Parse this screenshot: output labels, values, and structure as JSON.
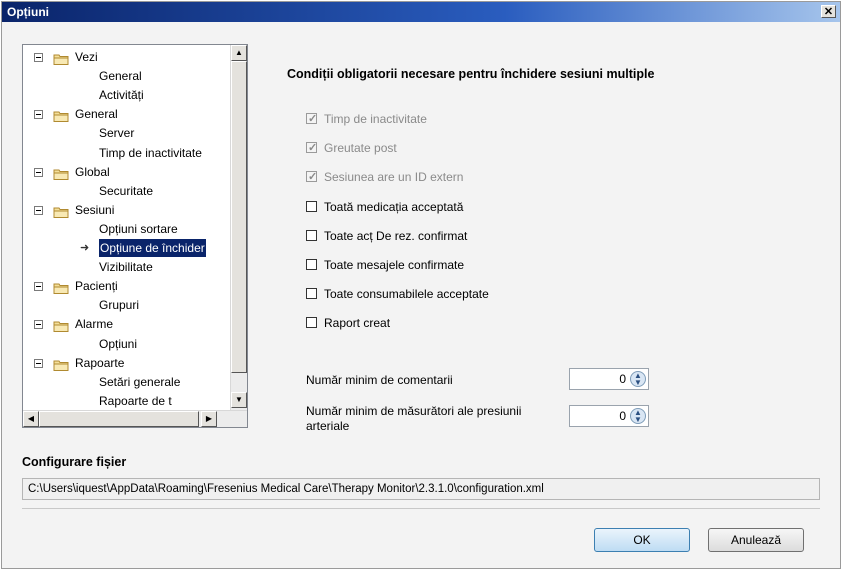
{
  "window": {
    "title": "Opțiuni",
    "close_glyph": "✕"
  },
  "tree": {
    "nodes": [
      {
        "label": "Vezi",
        "type": "group"
      },
      {
        "label": "General",
        "type": "leaf"
      },
      {
        "label": "Activități",
        "type": "leaf"
      },
      {
        "label": "General",
        "type": "group"
      },
      {
        "label": "Server",
        "type": "leaf"
      },
      {
        "label": "Timp de inactivitate",
        "type": "leaf"
      },
      {
        "label": "Global",
        "type": "group"
      },
      {
        "label": "Securitate",
        "type": "leaf"
      },
      {
        "label": "Sesiuni",
        "type": "group"
      },
      {
        "label": "Opțiuni sortare",
        "type": "leaf"
      },
      {
        "label": "Opțiune de închider",
        "type": "leaf",
        "selected": true
      },
      {
        "label": "Vizibilitate",
        "type": "leaf"
      },
      {
        "label": "Pacienți",
        "type": "group"
      },
      {
        "label": "Grupuri",
        "type": "leaf"
      },
      {
        "label": "Alarme",
        "type": "group"
      },
      {
        "label": "Opțiuni",
        "type": "leaf"
      },
      {
        "label": "Rapoarte",
        "type": "group"
      },
      {
        "label": "Setări generale",
        "type": "leaf"
      },
      {
        "label": "Rapoarte de t",
        "type": "leaf"
      }
    ]
  },
  "panel": {
    "heading": "Condiții obligatorii necesare pentru închidere sesiuni multiple",
    "checkboxes": [
      {
        "label": "Timp de inactivitate",
        "checked": true,
        "disabled": true
      },
      {
        "label": "Greutate post",
        "checked": true,
        "disabled": true
      },
      {
        "label": "Sesiunea are un ID extern",
        "checked": true,
        "disabled": true
      },
      {
        "label": "Toată medicația acceptată",
        "checked": false,
        "disabled": false
      },
      {
        "label": "Toate acț De rez. confirmat",
        "checked": false,
        "disabled": false
      },
      {
        "label": "Toate mesajele confirmate",
        "checked": false,
        "disabled": false
      },
      {
        "label": "Toate consumabilele acceptate",
        "checked": false,
        "disabled": false
      },
      {
        "label": "Raport creat",
        "checked": false,
        "disabled": false
      }
    ],
    "fields": [
      {
        "label": "Număr minim de comentarii",
        "value": "0"
      },
      {
        "label_line1": "Număr minim de măsurători ale presiunii",
        "label_line2": "arteriale",
        "value": "0"
      }
    ]
  },
  "config": {
    "label": "Configurare fișier",
    "path": "C:\\Users\\iquest\\AppData\\Roaming\\Fresenius Medical Care\\Therapy Monitor\\2.3.1.0\\configuration.xml"
  },
  "buttons": {
    "ok": "OK",
    "cancel": "Anulează"
  },
  "colors": {
    "selection": "#0a246a",
    "titlebar": "#0a246a"
  }
}
